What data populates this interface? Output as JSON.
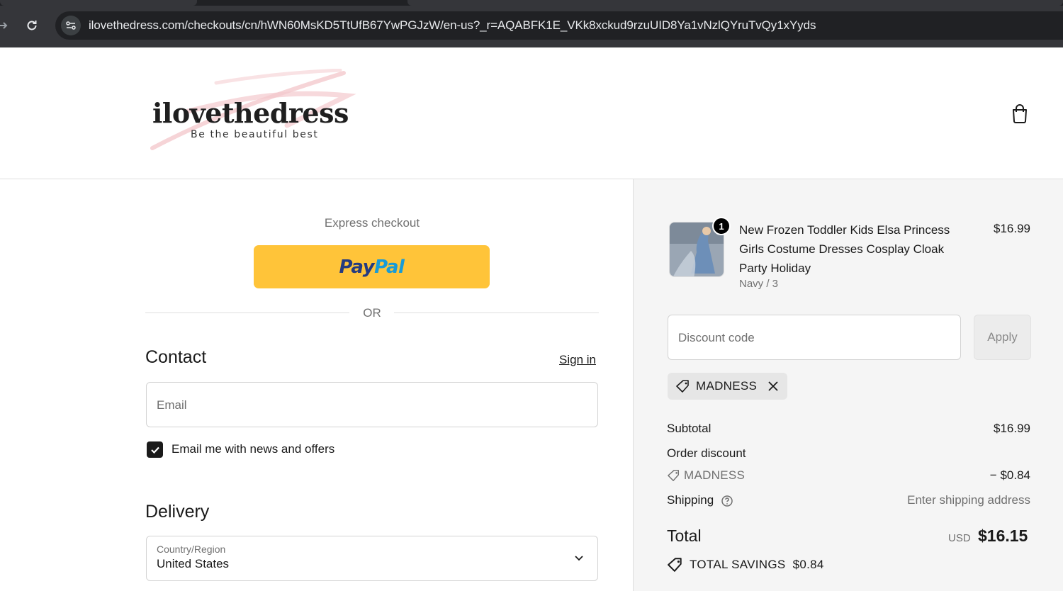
{
  "browser": {
    "url": "ilovethedress.com/checkouts/cn/hWN60MsKD5TtUfB67YwPGJzW/en-us?_r=AQABFK1E_VKk8xckud9rzuUID8Ya1vNzlQYruTvQy1xYyds"
  },
  "header": {
    "logo_text": "ilovethedress",
    "logo_tagline": "Be the beautiful best"
  },
  "express": {
    "label": "Express checkout",
    "paypal_pay": "Pay",
    "paypal_pal": "Pal",
    "or_label": "OR"
  },
  "contact": {
    "title": "Contact",
    "sign_in": "Sign in",
    "email_placeholder": "Email",
    "newsletter_label": "Email me with news and offers",
    "newsletter_checked": true
  },
  "delivery": {
    "title": "Delivery",
    "country_label": "Country/Region",
    "country_value": "United States"
  },
  "summary": {
    "item": {
      "name": "New Frozen Toddler Kids Elsa Princess Girls Costume Dresses Cosplay Cloak Party Holiday",
      "variant": "Navy / 3",
      "price": "$16.99",
      "quantity": "1"
    },
    "discount_placeholder": "Discount code",
    "apply_label": "Apply",
    "applied_code": "MADNESS",
    "subtotal_label": "Subtotal",
    "subtotal_value": "$16.99",
    "order_discount_label": "Order discount",
    "discount_code_label": "MADNESS",
    "discount_value": "− $0.84",
    "shipping_label": "Shipping",
    "shipping_value": "Enter shipping address",
    "total_label": "Total",
    "total_currency": "USD",
    "total_value": "$16.15",
    "savings_label": "TOTAL SAVINGS",
    "savings_value": "$0.84"
  },
  "colors": {
    "paypal_yellow": "#ffc439",
    "paypal_dark_blue": "#253b80",
    "paypal_light_blue": "#179bd7",
    "summary_bg": "#f5f5f5"
  }
}
